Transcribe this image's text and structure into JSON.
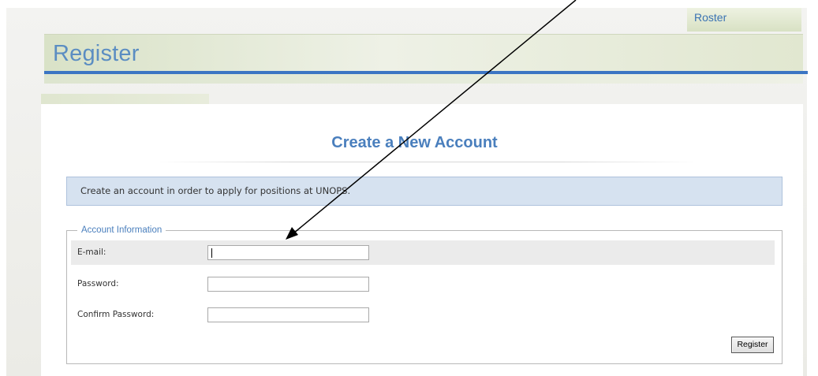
{
  "nav": {
    "roster_label": "Roster"
  },
  "header": {
    "title": "Register"
  },
  "main": {
    "heading": "Create a New Account",
    "info_text": "Create an account in order to apply for positions at UNOPS."
  },
  "form": {
    "legend": "Account Information",
    "fields": [
      {
        "label": "E-mail:",
        "value": ""
      },
      {
        "label": "Password:",
        "value": ""
      },
      {
        "label": "Confirm Password:",
        "value": ""
      }
    ],
    "submit_label": "Register"
  },
  "colors": {
    "accent_blue": "#3b75c3",
    "title_blue": "#5b8dc2",
    "info_panel": "#d6e2f0",
    "header_green": "#d9e2c7"
  },
  "icons": {
    "annotation": "arrow-annotation-icon"
  }
}
